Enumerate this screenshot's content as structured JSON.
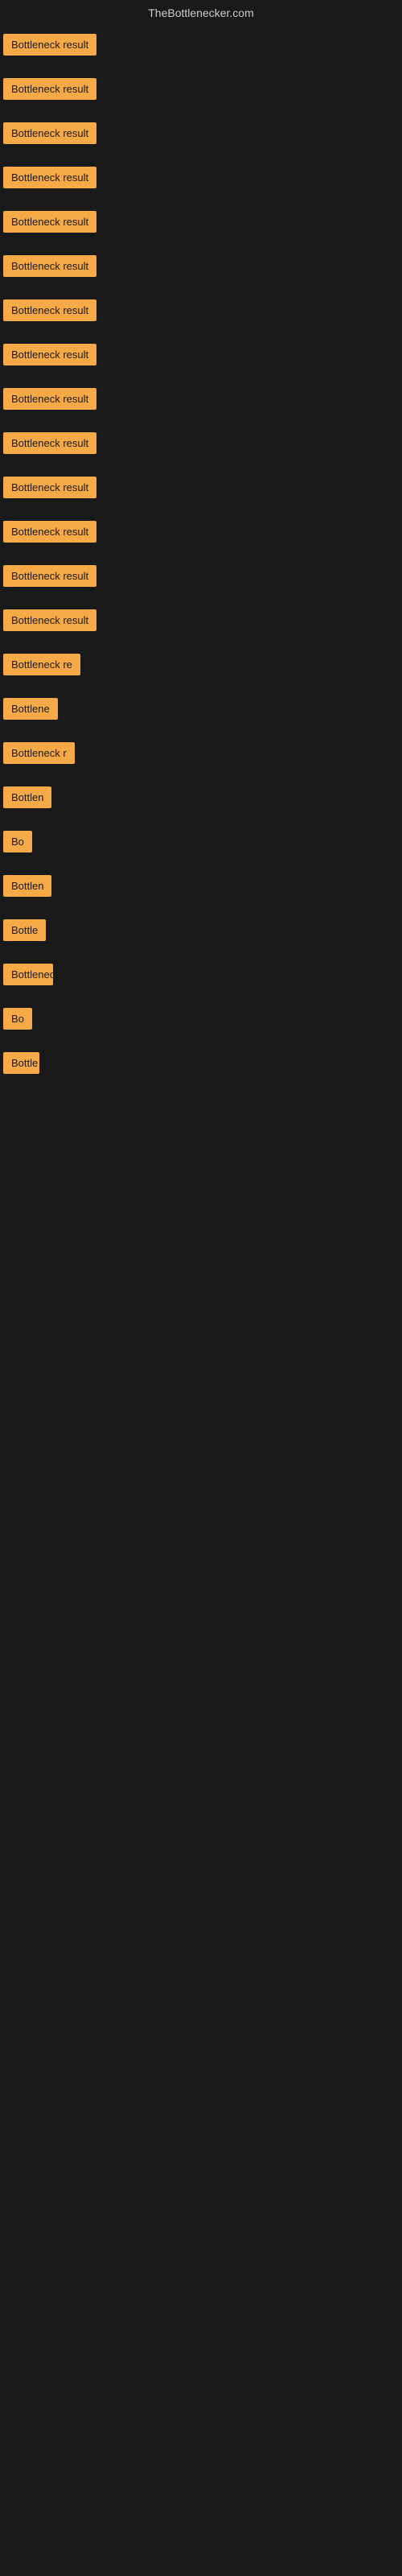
{
  "site": {
    "title": "TheBottlenecker.com"
  },
  "colors": {
    "badge_bg": "#f5a947",
    "badge_text": "#1a1a1a",
    "page_bg": "#1a1a1a"
  },
  "rows": [
    {
      "id": 1,
      "label": "Bottleneck result"
    },
    {
      "id": 2,
      "label": "Bottleneck result"
    },
    {
      "id": 3,
      "label": "Bottleneck result"
    },
    {
      "id": 4,
      "label": "Bottleneck result"
    },
    {
      "id": 5,
      "label": "Bottleneck result"
    },
    {
      "id": 6,
      "label": "Bottleneck result"
    },
    {
      "id": 7,
      "label": "Bottleneck result"
    },
    {
      "id": 8,
      "label": "Bottleneck result"
    },
    {
      "id": 9,
      "label": "Bottleneck result"
    },
    {
      "id": 10,
      "label": "Bottleneck result"
    },
    {
      "id": 11,
      "label": "Bottleneck result"
    },
    {
      "id": 12,
      "label": "Bottleneck result"
    },
    {
      "id": 13,
      "label": "Bottleneck result"
    },
    {
      "id": 14,
      "label": "Bottleneck result"
    },
    {
      "id": 15,
      "label": "Bottleneck re"
    },
    {
      "id": 16,
      "label": "Bottlene"
    },
    {
      "id": 17,
      "label": "Bottleneck r"
    },
    {
      "id": 18,
      "label": "Bottlen"
    },
    {
      "id": 19,
      "label": "Bo"
    },
    {
      "id": 20,
      "label": "Bottlen"
    },
    {
      "id": 21,
      "label": "Bottle"
    },
    {
      "id": 22,
      "label": "Bottlenec"
    },
    {
      "id": 23,
      "label": "Bo"
    },
    {
      "id": 24,
      "label": "Bottle"
    }
  ]
}
